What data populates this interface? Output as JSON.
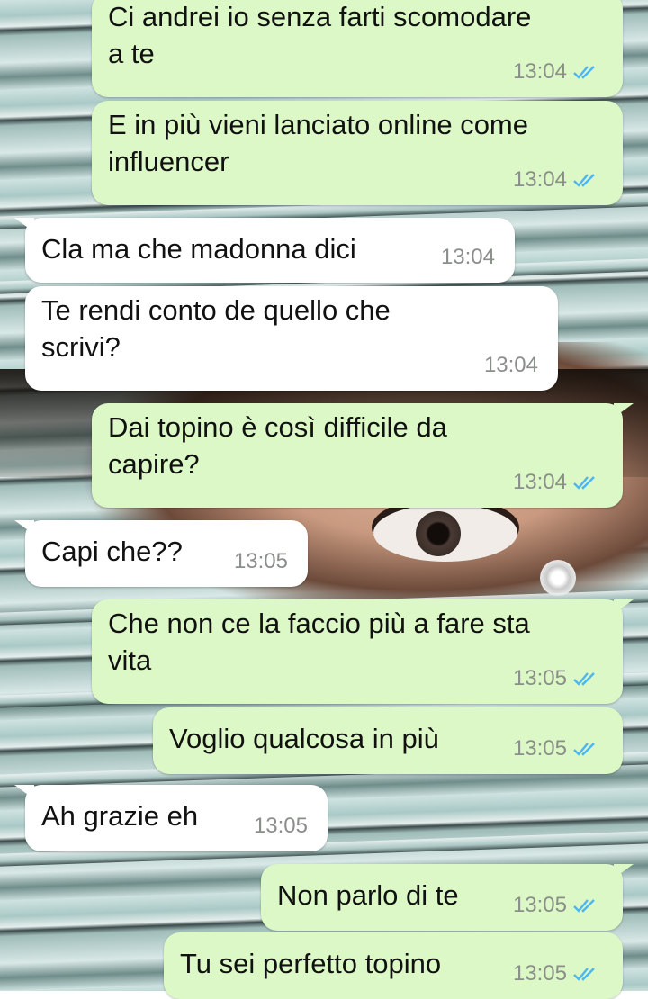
{
  "messages": [
    {
      "dir": "out",
      "text": "Ci andrei io senza farti scomodare\na te",
      "time": "13:04",
      "status": "read"
    },
    {
      "dir": "out",
      "text": "E in più vieni lanciato online come\ninfluencer",
      "time": "13:04",
      "status": "read"
    },
    {
      "dir": "in",
      "text": "Cla ma che madonna dici",
      "time": "13:04"
    },
    {
      "dir": "in",
      "text": "Te rendi conto de quello che\nscrivi?",
      "time": "13:04"
    },
    {
      "dir": "out",
      "text": "Dai topino è così difficile da\ncapire?",
      "time": "13:04",
      "status": "read"
    },
    {
      "dir": "in",
      "text": "Capi che??",
      "time": "13:05"
    },
    {
      "dir": "out",
      "text": "Che non ce la faccio più a fare sta\nvita",
      "time": "13:05",
      "status": "read"
    },
    {
      "dir": "out",
      "text": "Voglio qualcosa in più",
      "time": "13:05",
      "status": "read"
    },
    {
      "dir": "in",
      "text": "Ah grazie eh",
      "time": "13:05"
    },
    {
      "dir": "out",
      "text": "Non parlo di te",
      "time": "13:05",
      "status": "read"
    },
    {
      "dir": "out",
      "text": "Tu sei perfetto topino",
      "time": "13:05",
      "status": "read"
    }
  ],
  "colors": {
    "outgoing": "#dcf8c6",
    "incoming": "#ffffff",
    "read_ticks": "#4fb6ec",
    "timestamp": "#8a8f8a"
  },
  "icons": {
    "read_receipt": "double-check-icon"
  },
  "wallpaper": "venetian-blinds-eye-wallpaper"
}
